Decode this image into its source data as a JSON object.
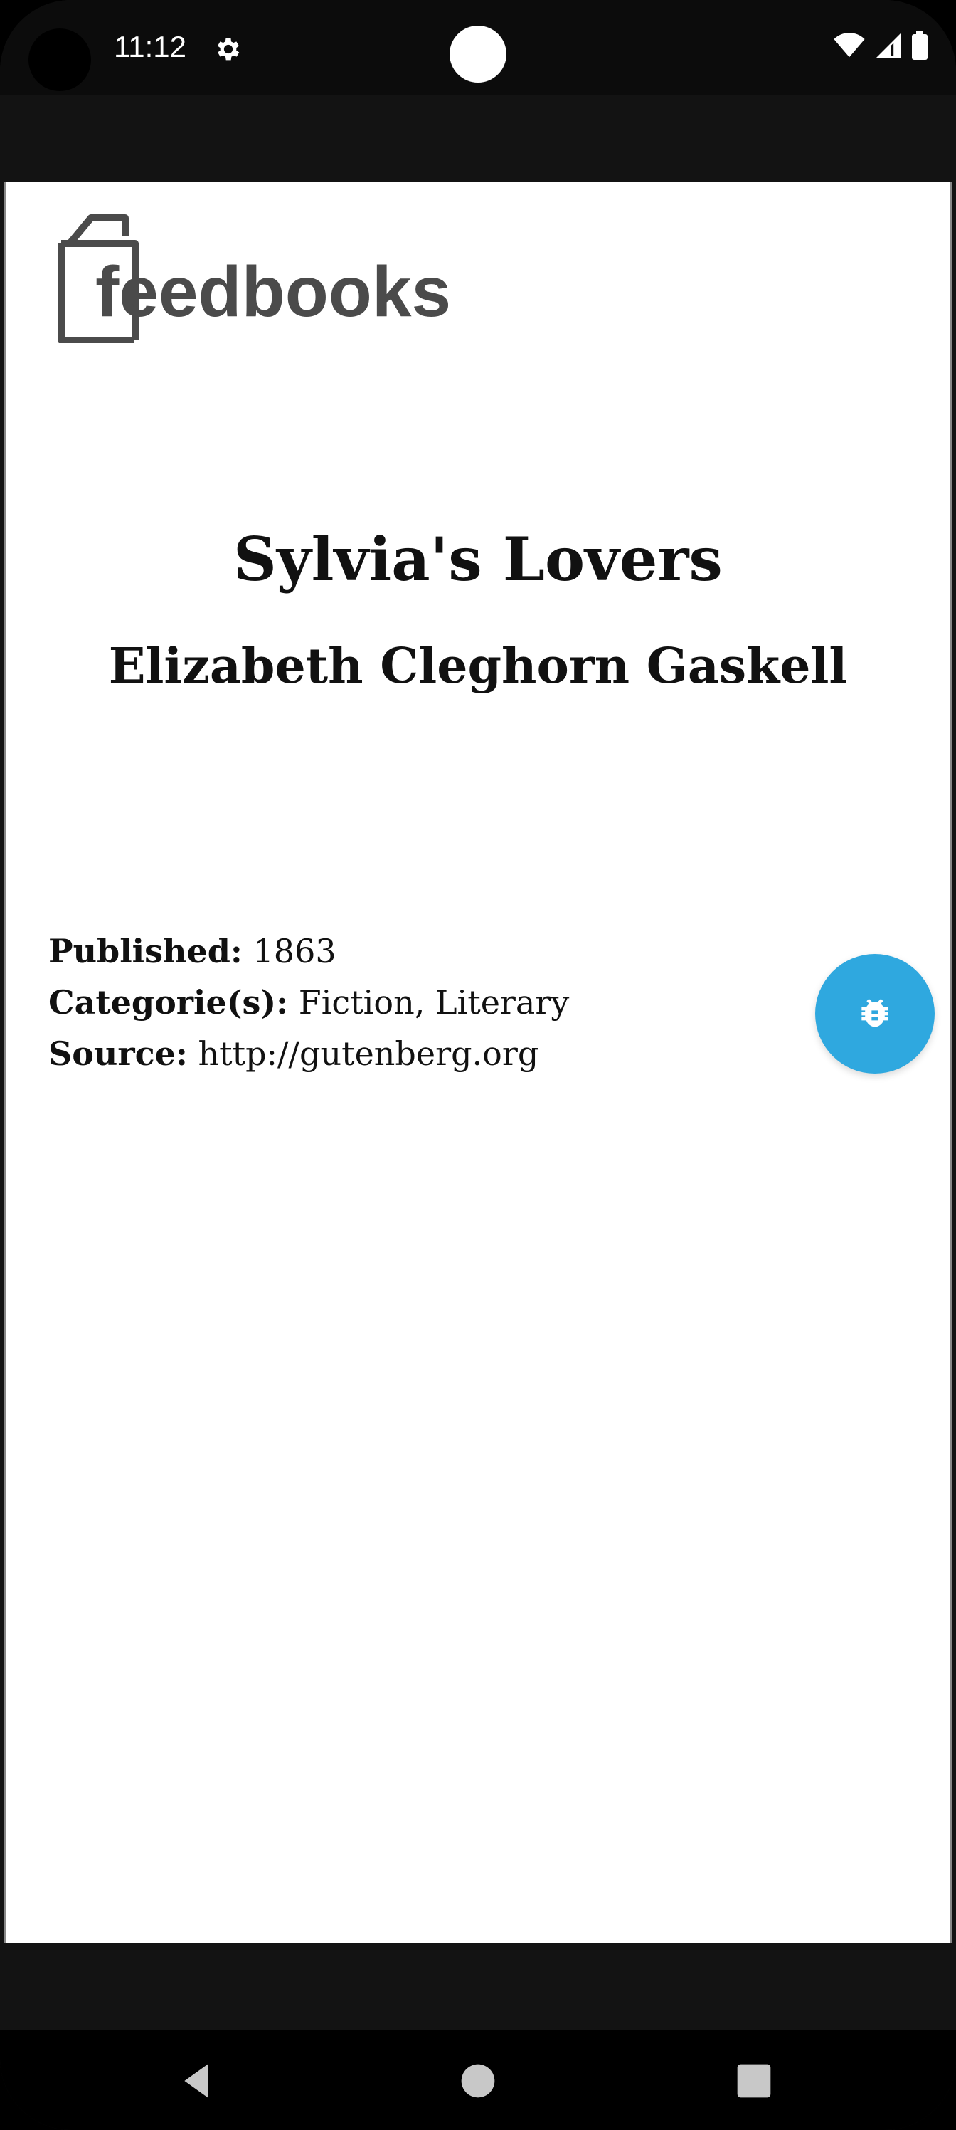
{
  "status_bar": {
    "time": "11:12",
    "icons": [
      "gear-icon",
      "wifi-icon",
      "signal-icon",
      "battery-icon"
    ]
  },
  "page": {
    "logo_text": "feedbooks",
    "title": "Sylvia's Lovers",
    "author": "Elizabeth Cleghorn Gaskell",
    "metadata": [
      {
        "key": "Published:",
        "value": "1863"
      },
      {
        "key": "Categorie(s):",
        "value": "Fiction, Literary"
      },
      {
        "key": "Source:",
        "value": "http://gutenberg.org"
      }
    ]
  },
  "fab": {
    "icon": "bug-icon",
    "color": "#2fa8df"
  },
  "nav_bar": {
    "icons": [
      "back-icon",
      "home-icon",
      "recents-icon"
    ]
  }
}
